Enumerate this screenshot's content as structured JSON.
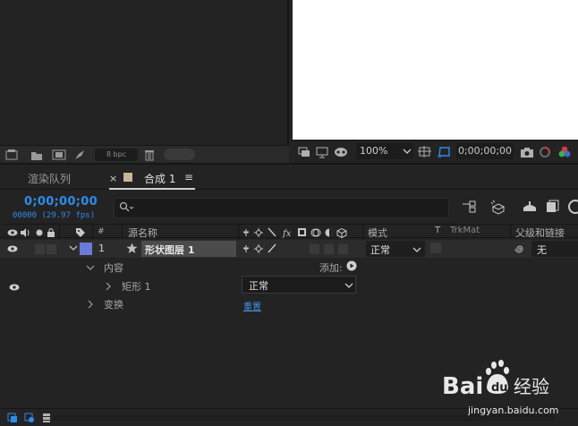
{
  "project_panel": {
    "bpc_label": "8 bpc"
  },
  "viewer": {
    "zoom": "100%",
    "timecode": "0;00;00;00"
  },
  "timeline": {
    "tabs": {
      "render_queue": "渲染队列",
      "comp": "合成 1",
      "close": "×",
      "menu": "≡"
    },
    "timecode": "0;00;00;00",
    "frame_fps": "00000 (29.97 fps)",
    "columns": {
      "hash": "#",
      "source_name": "源名称",
      "mode": "模式",
      "t": "T",
      "trkmat": "TrkMat",
      "parent": "父级和链接"
    },
    "layer": {
      "number": "1",
      "name": "形状图层 1",
      "mode": "正常",
      "parent": "无",
      "label_color": "#6a7bd8"
    },
    "properties": {
      "contents": "内容",
      "add": "添加:",
      "rect": "矩形 1",
      "blend_mode": "正常",
      "transform": "变换",
      "reset": "重置"
    }
  },
  "watermark": {
    "logo_text": "Baidu经验",
    "url": "jingyan.baidu.com"
  },
  "colors": {
    "accent_blue": "#2d8ceb",
    "panel_bg": "#232323",
    "viewer_bg": "#ffffff"
  }
}
